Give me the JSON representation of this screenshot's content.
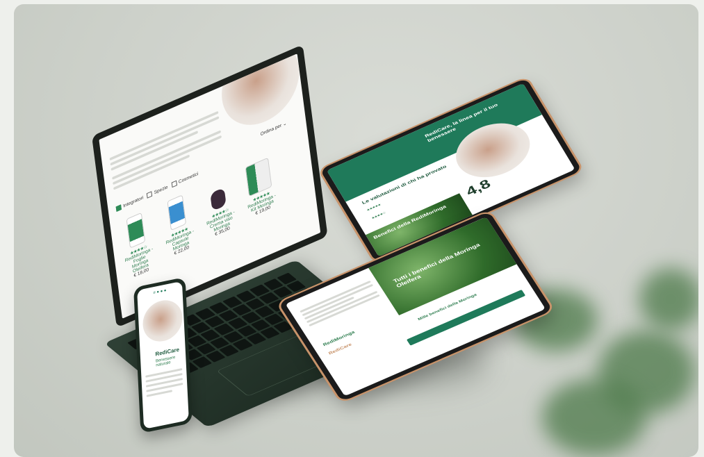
{
  "laptop": {
    "filters": [
      "Integratori",
      "Spezie",
      "Cosmetici"
    ],
    "sort_label": "Ordina per",
    "products": [
      {
        "name": "RediMoringa - Foglie Moringa Oleifera",
        "price": "€ 18,00"
      },
      {
        "name": "RediMoringa - Capsule Moringa",
        "price": "€ 22,00"
      },
      {
        "name": "RediMoringa - Crema viso Moringa",
        "price": "€ 35,00"
      },
      {
        "name": "RediMoringa - Kit Moringa",
        "price": "€ 19,00"
      }
    ]
  },
  "tablet_top": {
    "headline": "RediCare, la linea per il tuo benessere",
    "reviews_title": "Le valutazioni di chi ha provato",
    "rating": "4,8",
    "benefits_label": "Benefici della RediMoringa"
  },
  "tablet_front": {
    "headline": "Tutti i benefici della Moringa Oleifera",
    "brand1": "RediMoringa",
    "brand2": "RediCare",
    "cta": "Mille benefici della Moringa"
  },
  "phone": {
    "brand": "RediCare",
    "subtitle": "Benessere naturale"
  },
  "colors": {
    "accent": "#2e8b57",
    "dark_green": "#1f7a5a",
    "copper": "#c8936a"
  }
}
